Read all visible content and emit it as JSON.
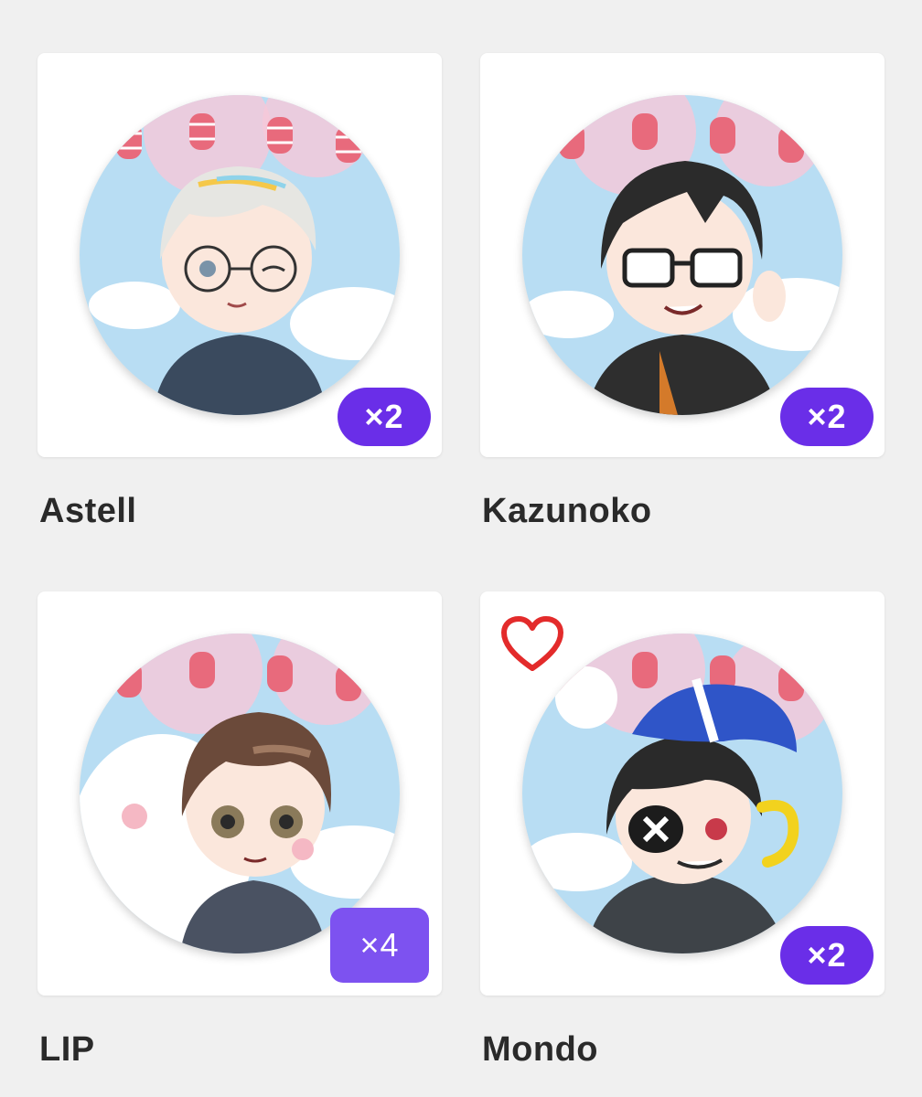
{
  "items": [
    {
      "name": "Astell",
      "quantity": "×2",
      "favorited": false,
      "hair": "#e6e6e2",
      "outfit": "#3a4a5e",
      "accessory": "glasses-round",
      "badge_style": "pill"
    },
    {
      "name": "Kazunoko",
      "quantity": "×2",
      "favorited": false,
      "hair": "#2b2b2b",
      "outfit": "#2e2e2e",
      "accessory": "glasses-square",
      "badge_style": "pill"
    },
    {
      "name": "LIP",
      "quantity": "×4",
      "favorited": false,
      "hair": "#6b4a3a",
      "outfit": "#4a5262",
      "accessory": "mascot",
      "badge_style": "pressed"
    },
    {
      "name": "Mondo",
      "quantity": "×2",
      "favorited": true,
      "hair": "#2a2a2a",
      "outfit": "#3e4348",
      "accessory": "hat-eyepatch",
      "badge_style": "pill"
    }
  ],
  "colors": {
    "badge_pill": "#6a2ee8",
    "badge_pressed": "#7d52f0",
    "heart": "#e32b2b",
    "sky": "#b8ddf3",
    "blossom": "#f6c8d8",
    "lantern": "#e86a7c",
    "page_bg": "#f0f0f0"
  },
  "icons": {
    "favorite": "heart-outline-icon"
  }
}
